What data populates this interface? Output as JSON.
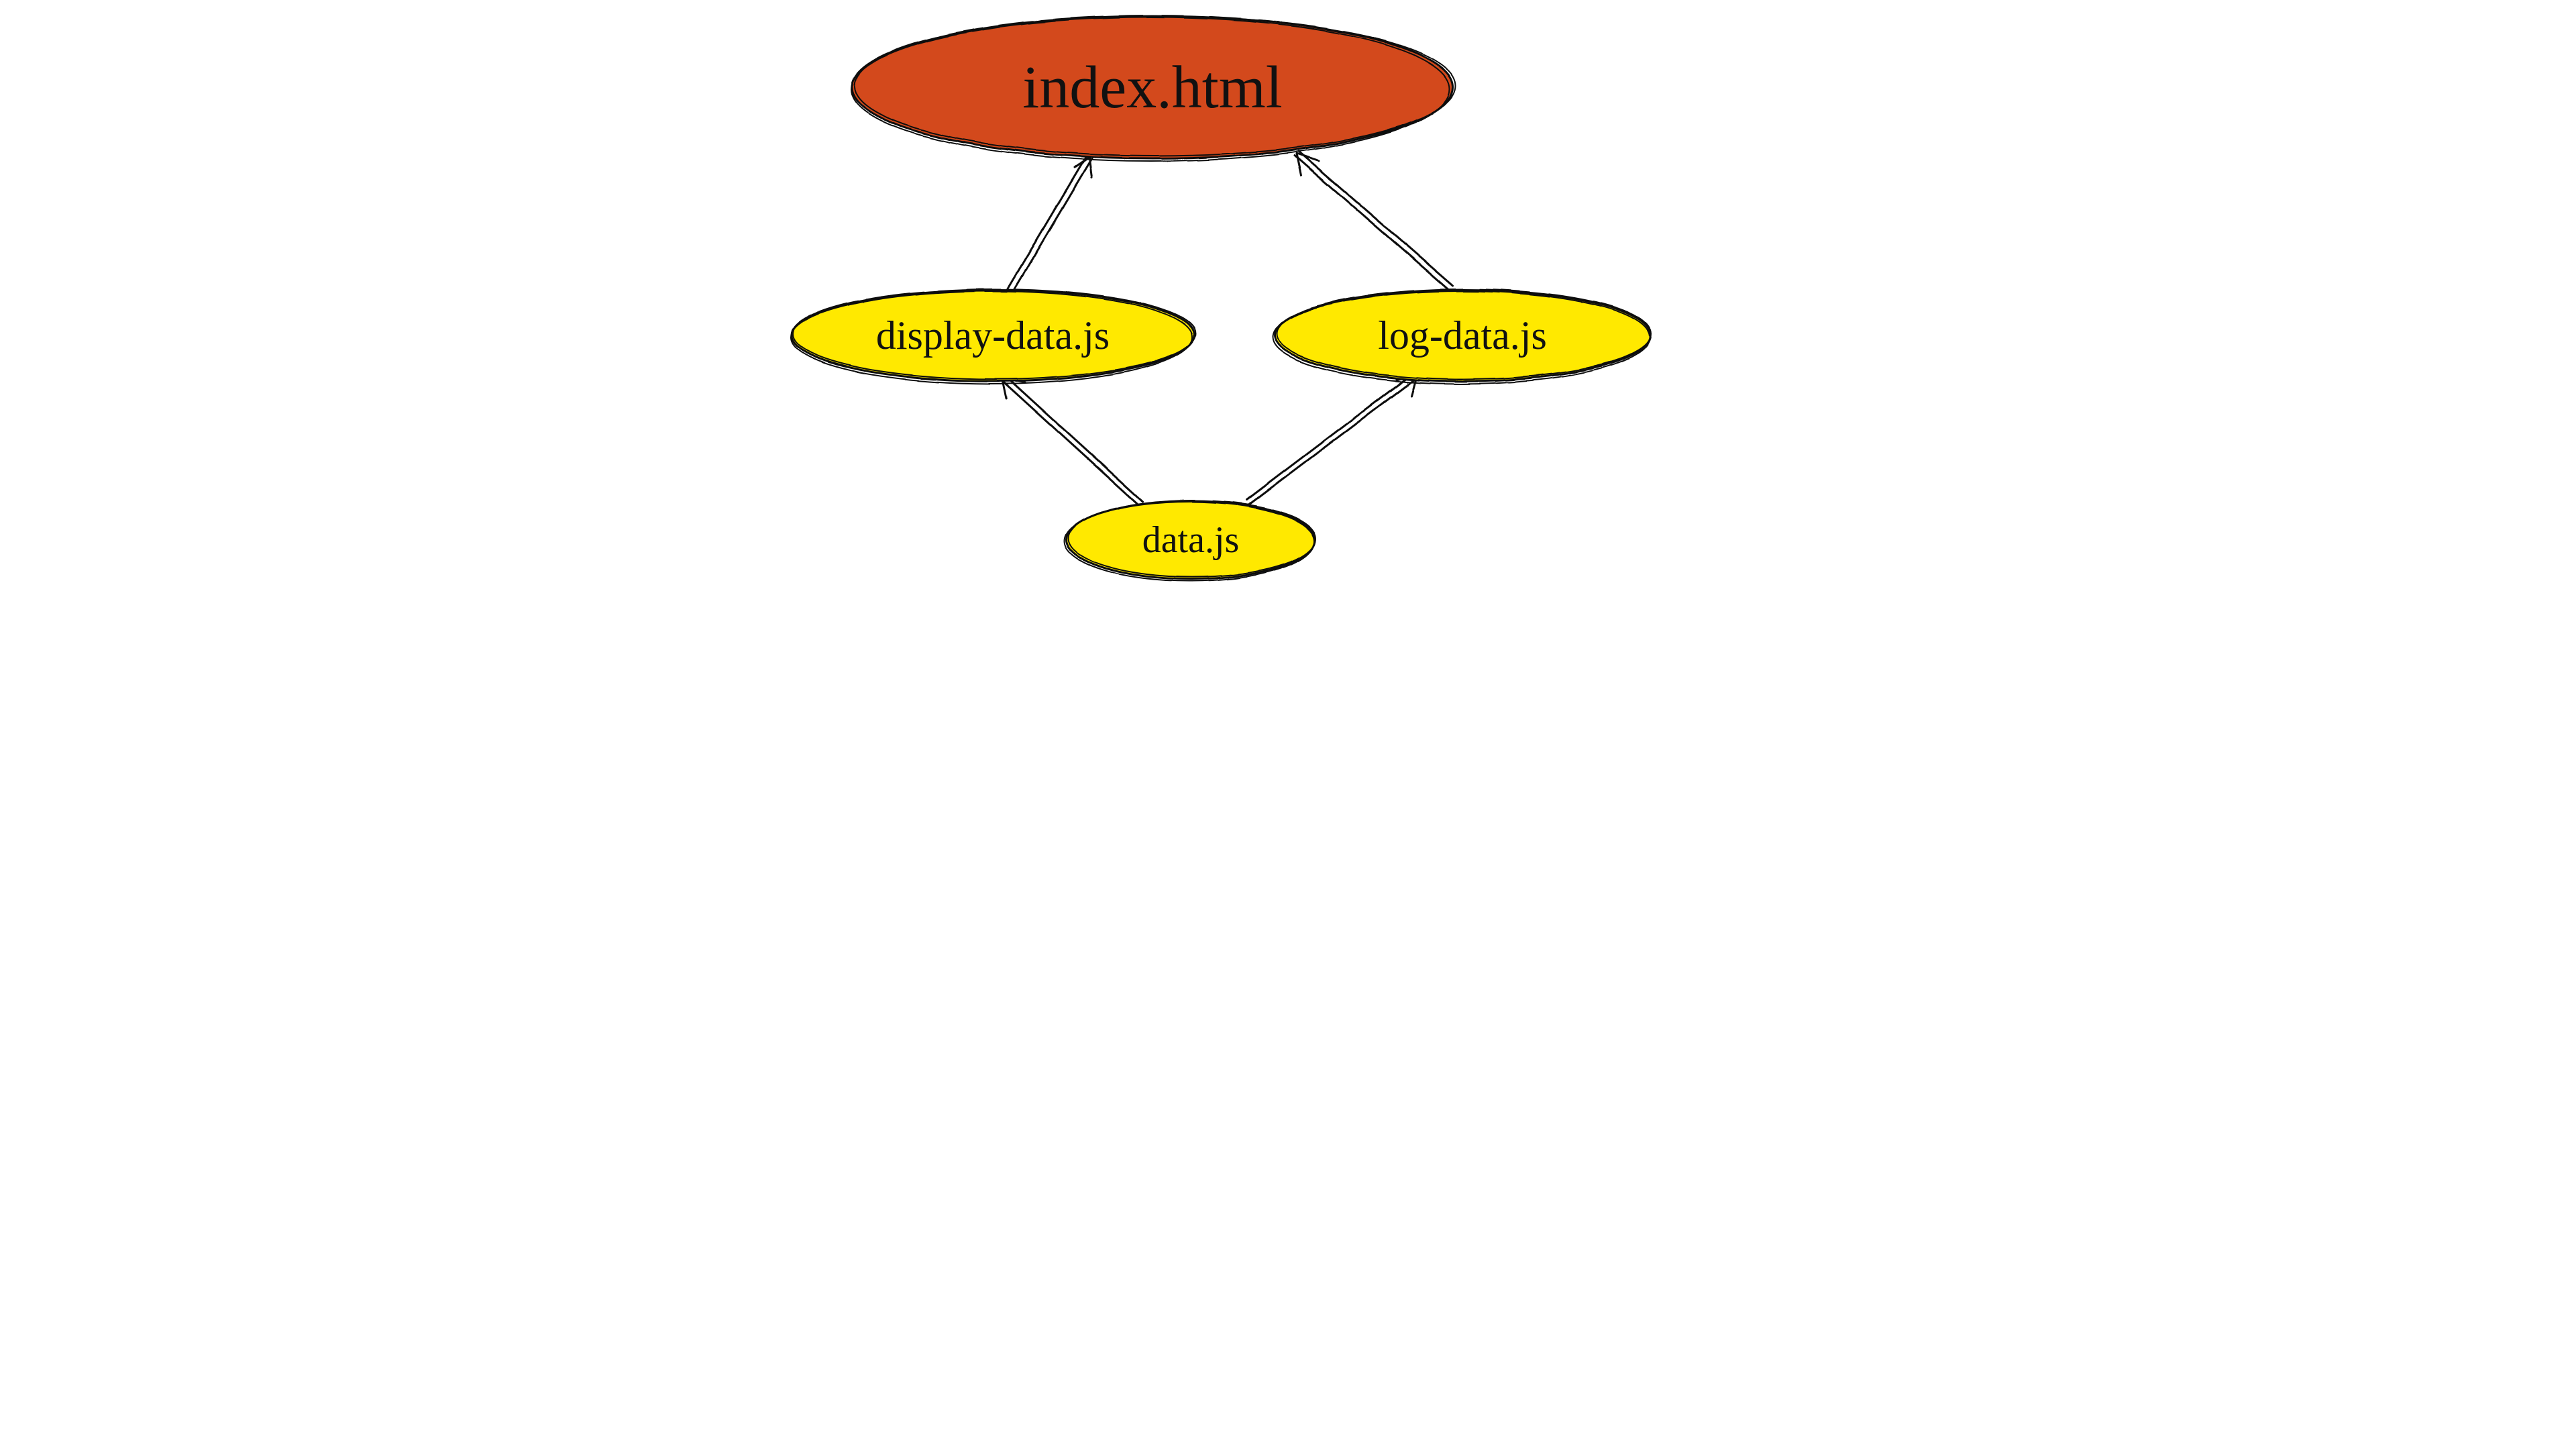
{
  "diagram": {
    "type": "dependency-graph",
    "style": "hand-drawn",
    "nodes": {
      "root": {
        "label": "index.html",
        "fill": "#d34a1a",
        "stroke": "#111111"
      },
      "left": {
        "label": "display-data.js",
        "fill": "#ffe900",
        "stroke": "#111111"
      },
      "right": {
        "label": "log-data.js",
        "fill": "#ffe900",
        "stroke": "#111111"
      },
      "bottom": {
        "label": "data.js",
        "fill": "#ffe900",
        "stroke": "#111111"
      }
    },
    "edges": [
      {
        "from": "left",
        "to": "root"
      },
      {
        "from": "right",
        "to": "root"
      },
      {
        "from": "bottom",
        "to": "left"
      },
      {
        "from": "bottom",
        "to": "right"
      }
    ]
  }
}
